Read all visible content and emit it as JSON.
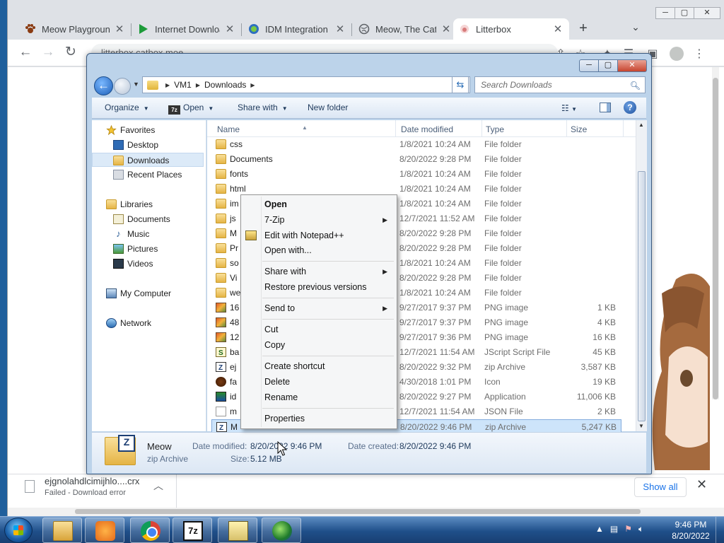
{
  "browser": {
    "tabs": [
      {
        "title": "Meow Playground",
        "icon": "paw-icon"
      },
      {
        "title": "Internet Download Manager",
        "icon": "idm-icon"
      },
      {
        "title": "IDM Integration Module",
        "icon": "idm-integration-icon"
      },
      {
        "title": "Meow, The Cat Pet",
        "icon": "globe-icon"
      },
      {
        "title": "Litterbox",
        "icon": "litterbox-icon"
      }
    ],
    "active_tab": 4,
    "address": "litterbox.catbox.moe",
    "window_controls": {
      "minimize": "─",
      "maximize": "▢",
      "close": "✕"
    },
    "downloads_bar": {
      "file_name": "ejgnolahdlcimijhlo....crx",
      "status": "Failed - Download error",
      "show_all": "Show all"
    }
  },
  "explorer": {
    "breadcrumb": [
      "VM1",
      "Downloads"
    ],
    "search_placeholder": "Search Downloads",
    "commands": {
      "organize": "Organize",
      "open": "Open",
      "share_with": "Share with",
      "new_folder": "New folder"
    },
    "nav": {
      "favorites": "Favorites",
      "desktop": "Desktop",
      "downloads": "Downloads",
      "recent_places": "Recent Places",
      "libraries": "Libraries",
      "documents": "Documents",
      "music": "Music",
      "pictures": "Pictures",
      "videos": "Videos",
      "my_computer": "My Computer",
      "network": "Network"
    },
    "columns": {
      "name": "Name",
      "date": "Date modified",
      "type": "Type",
      "size": "Size"
    },
    "files": [
      {
        "name": "css",
        "date": "1/8/2021 10:24 AM",
        "type": "File folder",
        "size": "",
        "kind": "folder"
      },
      {
        "name": "Documents",
        "date": "8/20/2022 9:28 PM",
        "type": "File folder",
        "size": "",
        "kind": "folder"
      },
      {
        "name": "fonts",
        "date": "1/8/2021 10:24 AM",
        "type": "File folder",
        "size": "",
        "kind": "folder"
      },
      {
        "name": "html",
        "date": "1/8/2021 10:24 AM",
        "type": "File folder",
        "size": "",
        "kind": "folder"
      },
      {
        "name": "im",
        "date": "1/8/2021 10:24 AM",
        "type": "File folder",
        "size": "",
        "kind": "folder"
      },
      {
        "name": "js",
        "date": "12/7/2021 11:52 AM",
        "type": "File folder",
        "size": "",
        "kind": "folder"
      },
      {
        "name": "M",
        "date": "8/20/2022 9:28 PM",
        "type": "File folder",
        "size": "",
        "kind": "folder"
      },
      {
        "name": "Pr",
        "date": "8/20/2022 9:28 PM",
        "type": "File folder",
        "size": "",
        "kind": "folder"
      },
      {
        "name": "so",
        "date": "1/8/2021 10:24 AM",
        "type": "File folder",
        "size": "",
        "kind": "folder"
      },
      {
        "name": "Vi",
        "date": "8/20/2022 9:28 PM",
        "type": "File folder",
        "size": "",
        "kind": "folder"
      },
      {
        "name": "we",
        "date": "1/8/2021 10:24 AM",
        "type": "File folder",
        "size": "",
        "kind": "folder"
      },
      {
        "name": "16",
        "date": "9/27/2017 9:37 PM",
        "type": "PNG image",
        "size": "1 KB",
        "kind": "png"
      },
      {
        "name": "48",
        "date": "9/27/2017 9:37 PM",
        "type": "PNG image",
        "size": "4 KB",
        "kind": "png"
      },
      {
        "name": "12",
        "date": "9/27/2017 9:36 PM",
        "type": "PNG image",
        "size": "16 KB",
        "kind": "png"
      },
      {
        "name": "ba",
        "date": "12/7/2021 11:54 AM",
        "type": "JScript Script File",
        "size": "45 KB",
        "kind": "js"
      },
      {
        "name": "ej",
        "date": "8/20/2022 9:32 PM",
        "type": "zip Archive",
        "size": "3,587 KB",
        "kind": "zip"
      },
      {
        "name": "fa",
        "date": "4/30/2018 1:01 PM",
        "type": "Icon",
        "size": "19 KB",
        "kind": "ico"
      },
      {
        "name": "id",
        "date": "8/20/2022 9:27 PM",
        "type": "Application",
        "size": "11,006 KB",
        "kind": "app"
      },
      {
        "name": "m",
        "date": "12/7/2021 11:54 AM",
        "type": "JSON File",
        "size": "2 KB",
        "kind": "json"
      },
      {
        "name": "M",
        "date": "8/20/2022 9:46 PM",
        "type": "zip Archive",
        "size": "5,247 KB",
        "kind": "zip"
      }
    ],
    "selected_row": 19,
    "details": {
      "name": "Meow",
      "type": "zip Archive",
      "date_modified_label": "Date modified:",
      "date_modified": "8/20/2022 9:46 PM",
      "date_created_label": "Date created:",
      "date_created": "8/20/2022 9:46 PM",
      "size_label": "Size:",
      "size": "5.12 MB"
    }
  },
  "context_menu": {
    "open": "Open",
    "seven_zip": "7-Zip",
    "edit_notepad": "Edit with Notepad++",
    "open_with": "Open with...",
    "share_with": "Share with",
    "restore": "Restore previous versions",
    "send_to": "Send to",
    "cut": "Cut",
    "copy": "Copy",
    "create_shortcut": "Create shortcut",
    "delete": "Delete",
    "rename": "Rename",
    "properties": "Properties"
  },
  "taskbar": {
    "time": "9:46 PM",
    "date": "8/20/2022",
    "seven_zip_label": "7z"
  }
}
